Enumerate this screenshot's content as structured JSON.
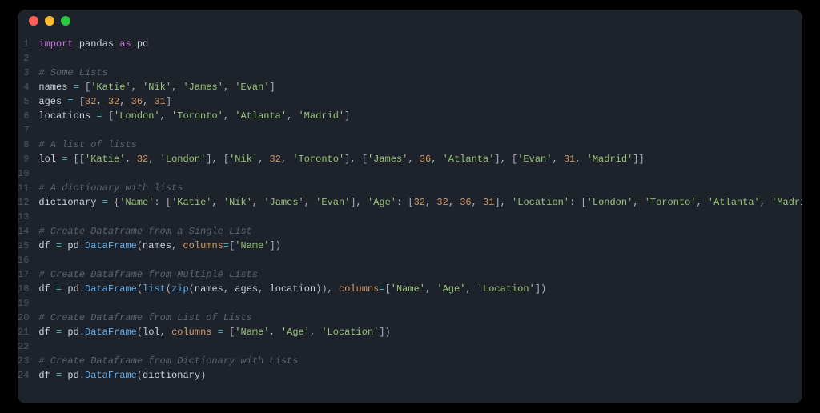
{
  "window": {
    "dots": [
      "close",
      "minimize",
      "zoom"
    ]
  },
  "code": {
    "total_lines": 24,
    "lines": [
      {
        "t": [
          [
            "kw",
            "import"
          ],
          [
            "sp",
            " "
          ],
          [
            "mod",
            "pandas"
          ],
          [
            "sp",
            " "
          ],
          [
            "kw",
            "as"
          ],
          [
            "sp",
            " "
          ],
          [
            "mod",
            "pd"
          ]
        ]
      },
      {
        "t": []
      },
      {
        "t": [
          [
            "cmt",
            "# Some Lists"
          ]
        ]
      },
      {
        "t": [
          [
            "id",
            "names"
          ],
          [
            "sp",
            " "
          ],
          [
            "op",
            "="
          ],
          [
            "sp",
            " "
          ],
          [
            "punc",
            "["
          ],
          [
            "str",
            "'Katie'"
          ],
          [
            "punc",
            ", "
          ],
          [
            "str",
            "'Nik'"
          ],
          [
            "punc",
            ", "
          ],
          [
            "str",
            "'James'"
          ],
          [
            "punc",
            ", "
          ],
          [
            "str",
            "'Evan'"
          ],
          [
            "punc",
            "]"
          ]
        ]
      },
      {
        "t": [
          [
            "id",
            "ages"
          ],
          [
            "sp",
            " "
          ],
          [
            "op",
            "="
          ],
          [
            "sp",
            " "
          ],
          [
            "punc",
            "["
          ],
          [
            "num",
            "32"
          ],
          [
            "punc",
            ", "
          ],
          [
            "num",
            "32"
          ],
          [
            "punc",
            ", "
          ],
          [
            "num",
            "36"
          ],
          [
            "punc",
            ", "
          ],
          [
            "num",
            "31"
          ],
          [
            "punc",
            "]"
          ]
        ]
      },
      {
        "t": [
          [
            "id",
            "locations"
          ],
          [
            "sp",
            " "
          ],
          [
            "op",
            "="
          ],
          [
            "sp",
            " "
          ],
          [
            "punc",
            "["
          ],
          [
            "str",
            "'London'"
          ],
          [
            "punc",
            ", "
          ],
          [
            "str",
            "'Toronto'"
          ],
          [
            "punc",
            ", "
          ],
          [
            "str",
            "'Atlanta'"
          ],
          [
            "punc",
            ", "
          ],
          [
            "str",
            "'Madrid'"
          ],
          [
            "punc",
            "]"
          ]
        ]
      },
      {
        "t": []
      },
      {
        "t": [
          [
            "cmt",
            "# A list of lists"
          ]
        ]
      },
      {
        "t": [
          [
            "id",
            "lol"
          ],
          [
            "sp",
            " "
          ],
          [
            "op",
            "="
          ],
          [
            "sp",
            " "
          ],
          [
            "punc",
            "[["
          ],
          [
            "str",
            "'Katie'"
          ],
          [
            "punc",
            ", "
          ],
          [
            "num",
            "32"
          ],
          [
            "punc",
            ", "
          ],
          [
            "str",
            "'London'"
          ],
          [
            "punc",
            "], ["
          ],
          [
            "str",
            "'Nik'"
          ],
          [
            "punc",
            ", "
          ],
          [
            "num",
            "32"
          ],
          [
            "punc",
            ", "
          ],
          [
            "str",
            "'Toronto'"
          ],
          [
            "punc",
            "], ["
          ],
          [
            "str",
            "'James'"
          ],
          [
            "punc",
            ", "
          ],
          [
            "num",
            "36"
          ],
          [
            "punc",
            ", "
          ],
          [
            "str",
            "'Atlanta'"
          ],
          [
            "punc",
            "], ["
          ],
          [
            "str",
            "'Evan'"
          ],
          [
            "punc",
            ", "
          ],
          [
            "num",
            "31"
          ],
          [
            "punc",
            ", "
          ],
          [
            "str",
            "'Madrid'"
          ],
          [
            "punc",
            "]]"
          ]
        ]
      },
      {
        "t": []
      },
      {
        "t": [
          [
            "cmt",
            "# A dictionary with lists"
          ]
        ]
      },
      {
        "t": [
          [
            "id",
            "dictionary"
          ],
          [
            "sp",
            " "
          ],
          [
            "op",
            "="
          ],
          [
            "sp",
            " "
          ],
          [
            "punc",
            "{"
          ],
          [
            "str",
            "'Name'"
          ],
          [
            "punc",
            ": ["
          ],
          [
            "str",
            "'Katie'"
          ],
          [
            "punc",
            ", "
          ],
          [
            "str",
            "'Nik'"
          ],
          [
            "punc",
            ", "
          ],
          [
            "str",
            "'James'"
          ],
          [
            "punc",
            ", "
          ],
          [
            "str",
            "'Evan'"
          ],
          [
            "punc",
            "], "
          ],
          [
            "str",
            "'Age'"
          ],
          [
            "punc",
            ": ["
          ],
          [
            "num",
            "32"
          ],
          [
            "punc",
            ", "
          ],
          [
            "num",
            "32"
          ],
          [
            "punc",
            ", "
          ],
          [
            "num",
            "36"
          ],
          [
            "punc",
            ", "
          ],
          [
            "num",
            "31"
          ],
          [
            "punc",
            "], "
          ],
          [
            "str",
            "'Location'"
          ],
          [
            "punc",
            ": ["
          ],
          [
            "str",
            "'London'"
          ],
          [
            "punc",
            ", "
          ],
          [
            "str",
            "'Toronto'"
          ],
          [
            "punc",
            ", "
          ],
          [
            "str",
            "'Atlanta'"
          ],
          [
            "punc",
            ", "
          ],
          [
            "str",
            "'Madrid'"
          ],
          [
            "punc",
            "]}"
          ]
        ]
      },
      {
        "t": []
      },
      {
        "t": [
          [
            "cmt",
            "# Create Dataframe from a Single List"
          ]
        ]
      },
      {
        "t": [
          [
            "id",
            "df"
          ],
          [
            "sp",
            " "
          ],
          [
            "op",
            "="
          ],
          [
            "sp",
            " "
          ],
          [
            "id",
            "pd"
          ],
          [
            "punc",
            "."
          ],
          [
            "fn",
            "DataFrame"
          ],
          [
            "punc",
            "("
          ],
          [
            "id",
            "names"
          ],
          [
            "punc",
            ", "
          ],
          [
            "param",
            "columns"
          ],
          [
            "op",
            "="
          ],
          [
            "punc",
            "["
          ],
          [
            "str",
            "'Name'"
          ],
          [
            "punc",
            "])"
          ]
        ]
      },
      {
        "t": []
      },
      {
        "t": [
          [
            "cmt",
            "# Create Dataframe from Multiple Lists"
          ]
        ]
      },
      {
        "t": [
          [
            "id",
            "df"
          ],
          [
            "sp",
            " "
          ],
          [
            "op",
            "="
          ],
          [
            "sp",
            " "
          ],
          [
            "id",
            "pd"
          ],
          [
            "punc",
            "."
          ],
          [
            "fn",
            "DataFrame"
          ],
          [
            "punc",
            "("
          ],
          [
            "fn",
            "list"
          ],
          [
            "punc",
            "("
          ],
          [
            "fn",
            "zip"
          ],
          [
            "punc",
            "("
          ],
          [
            "id",
            "names"
          ],
          [
            "punc",
            ", "
          ],
          [
            "id",
            "ages"
          ],
          [
            "punc",
            ", "
          ],
          [
            "id",
            "location"
          ],
          [
            "punc",
            ")), "
          ],
          [
            "param",
            "columns"
          ],
          [
            "op",
            "="
          ],
          [
            "punc",
            "["
          ],
          [
            "str",
            "'Name'"
          ],
          [
            "punc",
            ", "
          ],
          [
            "str",
            "'Age'"
          ],
          [
            "punc",
            ", "
          ],
          [
            "str",
            "'Location'"
          ],
          [
            "punc",
            "])"
          ]
        ]
      },
      {
        "t": []
      },
      {
        "t": [
          [
            "cmt",
            "# Create Dataframe from List of Lists"
          ]
        ]
      },
      {
        "t": [
          [
            "id",
            "df"
          ],
          [
            "sp",
            " "
          ],
          [
            "op",
            "="
          ],
          [
            "sp",
            " "
          ],
          [
            "id",
            "pd"
          ],
          [
            "punc",
            "."
          ],
          [
            "fn",
            "DataFrame"
          ],
          [
            "punc",
            "("
          ],
          [
            "id",
            "lol"
          ],
          [
            "punc",
            ", "
          ],
          [
            "param",
            "columns"
          ],
          [
            "sp",
            " "
          ],
          [
            "op",
            "="
          ],
          [
            "sp",
            " "
          ],
          [
            "punc",
            "["
          ],
          [
            "str",
            "'Name'"
          ],
          [
            "punc",
            ", "
          ],
          [
            "str",
            "'Age'"
          ],
          [
            "punc",
            ", "
          ],
          [
            "str",
            "'Location'"
          ],
          [
            "punc",
            "])"
          ]
        ]
      },
      {
        "t": []
      },
      {
        "t": [
          [
            "cmt",
            "# Create Dataframe from Dictionary with Lists"
          ]
        ]
      },
      {
        "t": [
          [
            "id",
            "df"
          ],
          [
            "sp",
            " "
          ],
          [
            "op",
            "="
          ],
          [
            "sp",
            " "
          ],
          [
            "id",
            "pd"
          ],
          [
            "punc",
            "."
          ],
          [
            "fn",
            "DataFrame"
          ],
          [
            "punc",
            "("
          ],
          [
            "id",
            "dictionary"
          ],
          [
            "punc",
            ")"
          ]
        ]
      }
    ]
  },
  "colors": {
    "bg": "#1e232b",
    "keyword": "#c678dd",
    "string": "#98c379",
    "number": "#d19a66",
    "function": "#61afef",
    "comment": "#5c6370",
    "operator": "#56b6c2"
  }
}
